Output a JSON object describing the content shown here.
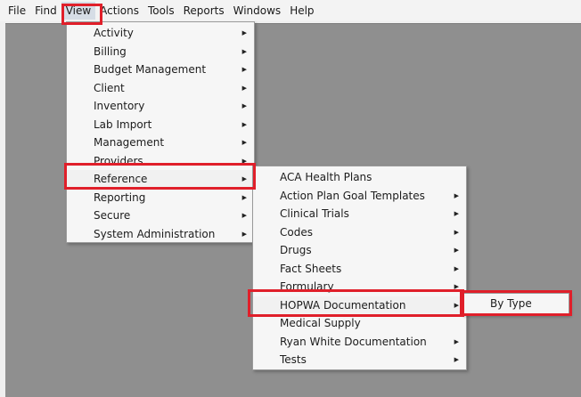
{
  "menubar": {
    "items": [
      {
        "label": "File",
        "active": false
      },
      {
        "label": "Find",
        "active": false
      },
      {
        "label": "View",
        "active": true
      },
      {
        "label": "Actions",
        "active": false
      },
      {
        "label": "Tools",
        "active": false
      },
      {
        "label": "Reports",
        "active": false
      },
      {
        "label": "Windows",
        "active": false
      },
      {
        "label": "Help",
        "active": false
      }
    ]
  },
  "view_menu": {
    "items": [
      {
        "label": "Activity"
      },
      {
        "label": "Billing"
      },
      {
        "label": "Budget Management"
      },
      {
        "label": "Client"
      },
      {
        "label": "Inventory"
      },
      {
        "label": "Lab Import"
      },
      {
        "label": "Management"
      },
      {
        "label": "Providers"
      },
      {
        "label": "Reference"
      },
      {
        "label": "Reporting"
      },
      {
        "label": "Secure"
      },
      {
        "label": "System Administration"
      }
    ]
  },
  "reference_menu": {
    "items": [
      {
        "label": "ACA Health Plans",
        "submenu": false
      },
      {
        "label": "Action Plan Goal Templates",
        "submenu": true
      },
      {
        "label": "Clinical Trials",
        "submenu": true
      },
      {
        "label": "Codes",
        "submenu": true
      },
      {
        "label": "Drugs",
        "submenu": true
      },
      {
        "label": "Fact Sheets",
        "submenu": true
      },
      {
        "label": "Formulary",
        "submenu": true
      },
      {
        "label": "HOPWA Documentation",
        "submenu": true
      },
      {
        "label": "Medical Supply",
        "submenu": false
      },
      {
        "label": "Ryan White Documentation",
        "submenu": true
      },
      {
        "label": "Tests",
        "submenu": true
      }
    ]
  },
  "hopwa_menu": {
    "items": [
      {
        "label": "By Type"
      }
    ]
  },
  "icons": {
    "submenu_arrow": "▶"
  },
  "colors": {
    "highlight": "#e01f2a",
    "workspace": "#8f8f8f"
  }
}
